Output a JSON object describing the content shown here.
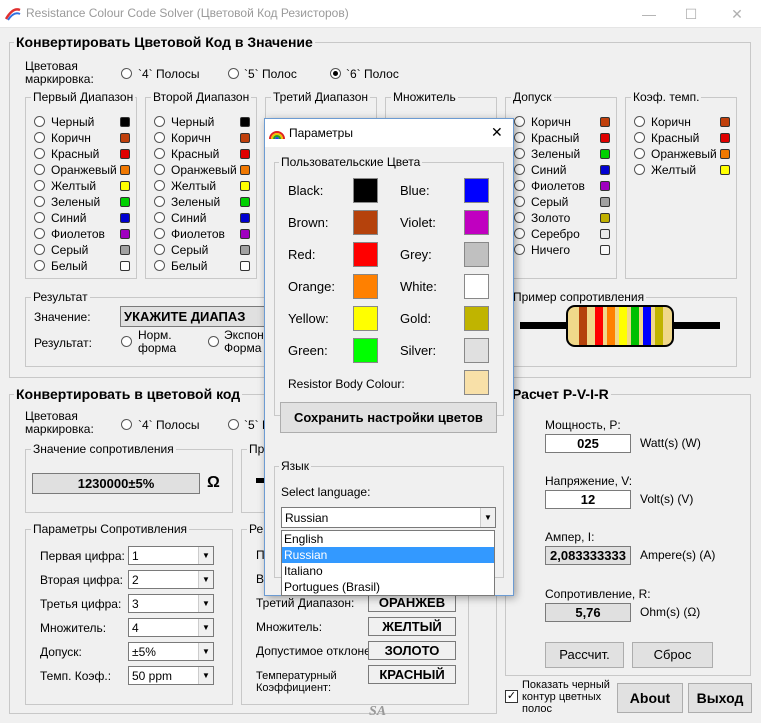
{
  "window": {
    "title": "Resistance Colour Code Solver (Цветовой Код Резисторов)",
    "min": "—",
    "max": "☐",
    "close": "✕"
  },
  "top": {
    "title": "Конвертировать Цветовой Код в Значение",
    "marking_label": "Цветовая маркировка:",
    "opt4": "`4` Полосы",
    "opt5": "`5` Полос",
    "opt6": "`6` Полос",
    "band1": {
      "title": "Первый Диапазон",
      "items": [
        "Черный",
        "Коричн",
        "Красный",
        "Оранжевый",
        "Желтый",
        "Зеленый",
        "Синий",
        "Фиолетов",
        "Серый",
        "Белый"
      ]
    },
    "band2": {
      "title": "Второй Диапазон",
      "items": [
        "Черный",
        "Коричн",
        "Красный",
        "Оранжевый",
        "Желтый",
        "Зеленый",
        "Синий",
        "Фиолетов",
        "Серый",
        "Белый"
      ]
    },
    "band3": {
      "title": "Третий Диапазон"
    },
    "mult": {
      "title": "Множитель"
    },
    "tol": {
      "title": "Допуск",
      "items": [
        "Коричн",
        "Красный",
        "Зеленый",
        "Синий",
        "Фиолетов",
        "Серый",
        "Золото",
        "Серебро",
        "Ничего"
      ]
    },
    "tc": {
      "title": "Коэф. темп.",
      "items": [
        "Коричн",
        "Красный",
        "Оранжевый",
        "Желтый"
      ]
    },
    "result": {
      "title": "Результат",
      "value_label": "Значение:",
      "value": "УКАЖИТЕ ДИАПАЗ",
      "res_label": "Результат:",
      "norm": "Норм. форма",
      "exp": "Экспон Форма"
    },
    "example_title": "Пример сопротивления"
  },
  "bottom": {
    "title": "Конвертировать в цветовой код",
    "marking_label": "Цветовая маркировка:",
    "opt4": "`4` Полосы",
    "opt5": "`5` П",
    "value_group": "Значение сопротивления",
    "value": "1230000±5%",
    "ohm": "Ω",
    "params_title": "Параметры Сопротивления",
    "params": [
      {
        "label": "Первая цифра:",
        "value": "1"
      },
      {
        "label": "Вторая цифра:",
        "value": "2"
      },
      {
        "label": "Третья цифра:",
        "value": "3"
      },
      {
        "label": "Множитель:",
        "value": "4"
      },
      {
        "label": "Допуск:",
        "value": "±5%"
      },
      {
        "label": "Темп. Коэф.:",
        "value": "50 ppm"
      }
    ],
    "res_title": "Ре",
    "res_pr": "Пр",
    "res_rows": [
      {
        "label": "П",
        "value": ""
      },
      {
        "label": "В",
        "value": ""
      },
      {
        "label": "Третий Диапазон:",
        "value": "ОРАНЖЕВ"
      },
      {
        "label": "Множитель:",
        "value": "ЖЕЛТЫЙ"
      },
      {
        "label": "Допустимое отклоне",
        "value": "ЗОЛОТО"
      },
      {
        "label": "Температурный Коэффициент:",
        "value": "КРАСНЫЙ"
      }
    ]
  },
  "pvir": {
    "title": "Расчет P-V-I-R",
    "p_label": "Мощность, P:",
    "p": "025",
    "p_unit": "Watt(s) (W)",
    "v_label": "Напряжение, V:",
    "v": "12",
    "v_unit": "Volt(s) (V)",
    "i_label": "Ампер, I:",
    "i": "2,083333333",
    "i_unit": "Ampere(s) (A)",
    "r_label": "Сопротивление, R:",
    "r": "5,76",
    "r_unit": "Ohm(s) (Ω)",
    "calc": "Рассчит.",
    "reset": "Сброс"
  },
  "footer": {
    "checkbox": "Показать черный контур цветных полос",
    "about": "About",
    "exit": "Выход",
    "logo": "SA"
  },
  "dialog": {
    "title": "Параметры",
    "close": "✕",
    "colors_title": "Пользовательские Цвета",
    "left": [
      {
        "name": "Black:",
        "color": "#000000"
      },
      {
        "name": "Brown:",
        "color": "#b5420c"
      },
      {
        "name": "Red:",
        "color": "#ff0000"
      },
      {
        "name": "Orange:",
        "color": "#ff8000"
      },
      {
        "name": "Yellow:",
        "color": "#ffff00"
      },
      {
        "name": "Green:",
        "color": "#00ff00"
      }
    ],
    "right": [
      {
        "name": "Blue:",
        "color": "#0000ff"
      },
      {
        "name": "Violet:",
        "color": "#c000c0"
      },
      {
        "name": "Grey:",
        "color": "#c0c0c0"
      },
      {
        "name": "White:",
        "color": "#ffffff"
      },
      {
        "name": "Gold:",
        "color": "#c0b400"
      },
      {
        "name": "Silver:",
        "color": "#e0e0e0"
      }
    ],
    "body_label": "Resistor Body Colour:",
    "body_color": "#f8e0a8",
    "save": "Сохранить настройки цветов",
    "lang_title": "Язык",
    "select_label": "Select language:",
    "lang_value": "Russian",
    "options": [
      "English",
      "Russian",
      "Italiano",
      "Portugues (Brasil)"
    ]
  }
}
